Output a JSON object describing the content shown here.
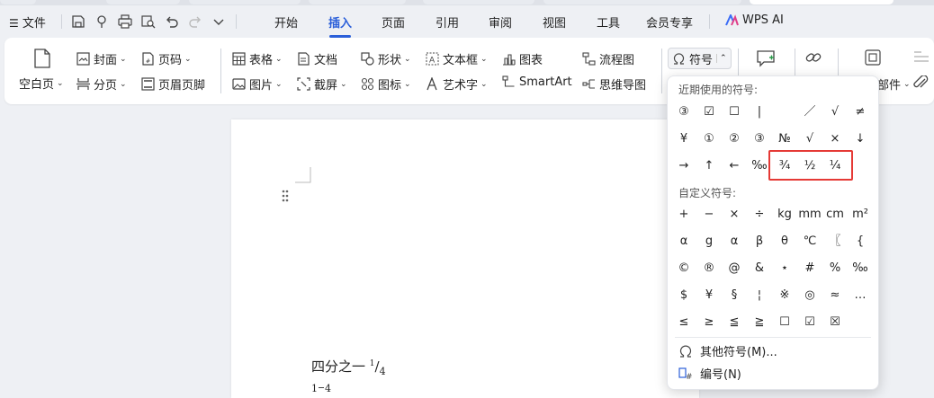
{
  "menubar": {
    "file": "文件",
    "tabs": [
      "开始",
      "插入",
      "页面",
      "引用",
      "审阅",
      "视图",
      "工具",
      "会员专享"
    ],
    "active_tab": "插入",
    "wps_ai": "WPS AI"
  },
  "ribbon": {
    "blank_page": "空白页",
    "cover": "封面",
    "page_number": "页码",
    "page_break": "分页",
    "header_footer": "页眉页脚",
    "table": "表格",
    "document": "文档",
    "shape": "形状",
    "text_box": "文本框",
    "chart": "图表",
    "flowchart": "流程图",
    "symbol": "符号",
    "picture": "图片",
    "screenshot": "截屏",
    "icon": "图标",
    "art_text": "艺术字",
    "smartart": "SmartArt",
    "mindmap": "思维导图",
    "part_label": "部件"
  },
  "document": {
    "line1_text": "四分之一 ",
    "line1_num": "1",
    "line1_slash": "/",
    "line1_den": "4",
    "line2_num": "1",
    "line2_den": "4"
  },
  "symbol_popup": {
    "recent_label": "近期使用的符号:",
    "recent": [
      [
        "③",
        "☑",
        "☐",
        "|",
        "",
        "／",
        "√",
        "≠"
      ],
      [
        "¥",
        "①",
        "②",
        "③",
        "№",
        "√",
        "×",
        "↓"
      ],
      [
        "→",
        "↑",
        "←",
        "‰",
        "¾",
        "½",
        "¼",
        ""
      ]
    ],
    "custom_label": "自定义符号:",
    "custom": [
      [
        "+",
        "−",
        "×",
        "÷",
        "kg",
        "mm",
        "cm",
        "m²"
      ],
      [
        "α",
        "g",
        "α",
        "β",
        "θ",
        "℃",
        "〖",
        "{"
      ],
      [
        "©",
        "®",
        "@",
        "&",
        "⋆",
        "#",
        "%",
        "‰"
      ],
      [
        "$",
        "¥",
        "§",
        "¦",
        "※",
        "◎",
        "≈",
        "…"
      ],
      [
        "≤",
        "≥",
        "≦",
        "≧",
        "☐",
        "☑",
        "☒",
        ""
      ]
    ],
    "more_symbols": "其他符号(M)...",
    "numbering": "编号(N)"
  },
  "colors": {
    "accent": "#2b5fd9",
    "highlight": "#e53935"
  }
}
